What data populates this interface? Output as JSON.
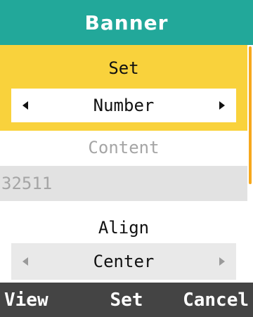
{
  "header": {
    "title": "Banner"
  },
  "set": {
    "label": "Set",
    "value": "Number"
  },
  "content": {
    "label": "Content",
    "value": "32511"
  },
  "align": {
    "label": "Align",
    "value": "Center"
  },
  "softkeys": {
    "left": "View",
    "center": "Set",
    "right": "Cancel"
  },
  "colors": {
    "header_bg": "#22a89a",
    "focus_bg": "#f9d23c",
    "scrollbar": "#f6a81c",
    "softkey_bg": "#444444",
    "disabled_text": "#a5a5a5"
  },
  "icons": {
    "set_left": "arrow-left-icon",
    "set_right": "arrow-right-icon",
    "align_left": "arrow-left-icon",
    "align_right": "arrow-right-icon"
  }
}
